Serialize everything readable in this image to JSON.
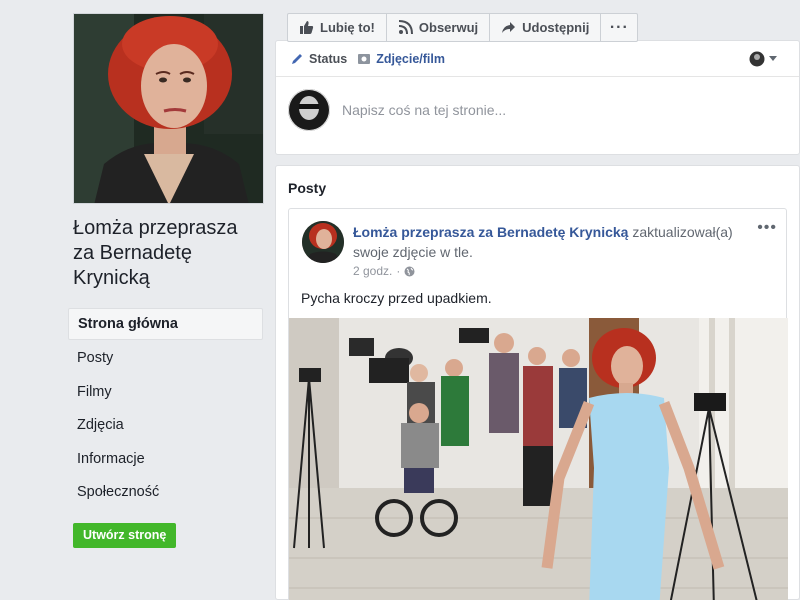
{
  "page": {
    "name": "Łomża przeprasza za Bernadetę Krynicką"
  },
  "sidebar": {
    "items": [
      {
        "label": "Strona główna"
      },
      {
        "label": "Posty"
      },
      {
        "label": "Filmy"
      },
      {
        "label": "Zdjęcia"
      },
      {
        "label": "Informacje"
      },
      {
        "label": "Społeczność"
      }
    ],
    "create_page_label": "Utwórz stronę"
  },
  "toolbar": {
    "like_label": "Lubię to!",
    "follow_label": "Obserwuj",
    "share_label": "Udostępnij",
    "more_label": "···"
  },
  "composer": {
    "tab_status": "Status",
    "tab_photo": "Zdjęcie/film",
    "placeholder": "Napisz coś na tej stronie..."
  },
  "posts": {
    "title": "Posty",
    "post": {
      "author": "Łomża przeprasza za Bernadetę Krynicką",
      "action": "zaktualizował(a) swoje zdjęcie w tle.",
      "time": "2 godz.",
      "separator": "·",
      "text": "Pycha kroczy przed upadkiem.",
      "more_label": "•••"
    }
  },
  "colors": {
    "link": "#365899",
    "create_button": "#42b72a",
    "background": "#e9ebee"
  }
}
